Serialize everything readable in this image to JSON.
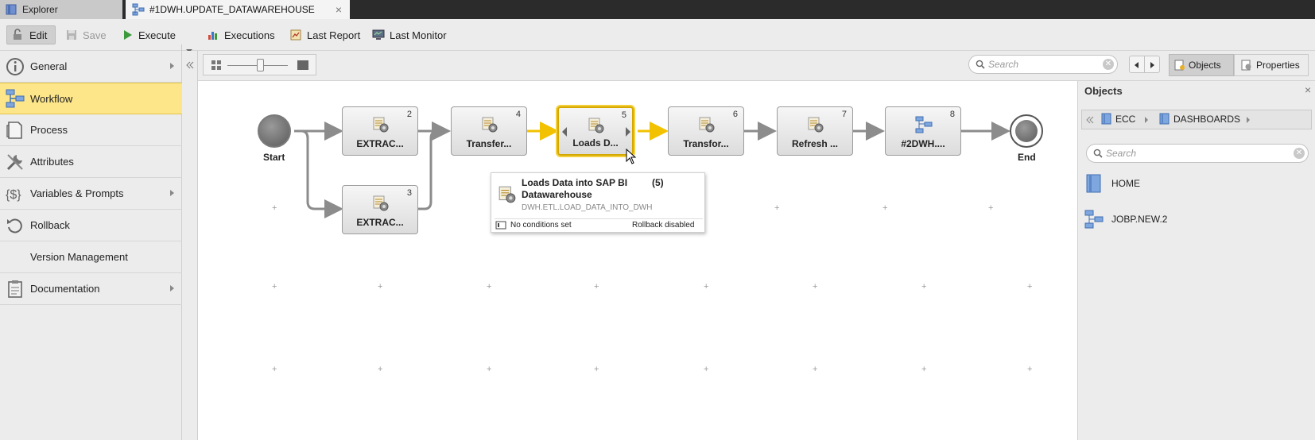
{
  "tabs": {
    "explorer_label": "Explorer",
    "active_label": "#1DWH.UPDATE_DATAWAREHOUSE",
    "close_glyph": "×"
  },
  "toolbar": {
    "edit_label": "Edit",
    "save_label": "Save",
    "execute_label": "Execute",
    "executions_label": "Executions",
    "last_report_label": "Last Report",
    "last_monitor_label": "Last Monitor"
  },
  "sidebar": {
    "items": [
      {
        "label": "General",
        "icon": "info-icon",
        "has_arrow": true
      },
      {
        "label": "Workflow",
        "icon": "workflow-icon",
        "active": true
      },
      {
        "label": "Process",
        "icon": "document-icon"
      },
      {
        "label": "Attributes",
        "icon": "wrench-icon"
      },
      {
        "label": "Variables & Prompts",
        "icon": "variables-icon",
        "has_arrow": true
      },
      {
        "label": "Rollback",
        "icon": "rollback-icon"
      },
      {
        "label": "Version Management",
        "icon": "version-icon"
      },
      {
        "label": "Documentation",
        "icon": "clipboard-icon",
        "has_arrow": true
      }
    ]
  },
  "canvas_toolbar": {
    "search_placeholder": "Search",
    "objects_label": "Objects",
    "properties_label": "Properties"
  },
  "workflow": {
    "start_label": "Start",
    "end_label": "End",
    "nodes": [
      {
        "num": "2",
        "label": "EXTRAC..."
      },
      {
        "num": "3",
        "label": "EXTRAC..."
      },
      {
        "num": "4",
        "label": "Transfer..."
      },
      {
        "num": "5",
        "label": "Loads D..."
      },
      {
        "num": "6",
        "label": "Transfor..."
      },
      {
        "num": "7",
        "label": "Refresh ..."
      },
      {
        "num": "8",
        "label": "#2DWH...."
      }
    ],
    "tooltip": {
      "title": "Loads Data into SAP BI Datawarehouse",
      "num": "(5)",
      "object_name": "DWH.ETL.LOAD_DATA_INTO_DWH",
      "conditions": "No conditions set",
      "rollback": "Rollback disabled"
    }
  },
  "objects_panel": {
    "title": "Objects",
    "breadcrumb": [
      "ECC",
      "DASHBOARDS"
    ],
    "search_placeholder": "Search",
    "items": [
      {
        "label": "HOME",
        "icon": "folder-icon"
      },
      {
        "label": "JOBP.NEW.2",
        "icon": "workflow-icon"
      }
    ]
  },
  "colors": {
    "active_nav": "#fde68a",
    "selected_border": "#d4a800",
    "active_connector": "#f2c200",
    "connector": "#8c8c8c"
  }
}
